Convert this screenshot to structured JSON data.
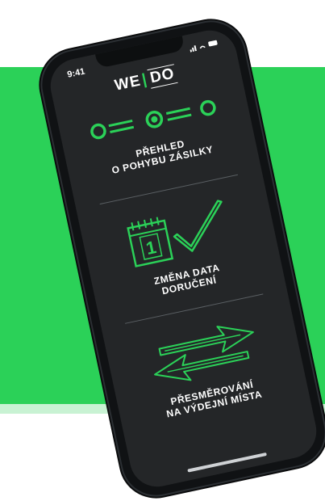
{
  "status": {
    "time": "9:41",
    "icons": "…• ▴ ▬"
  },
  "logo": {
    "left": "WE",
    "right": "DO"
  },
  "sections": [
    {
      "title": [
        "PŘEHLED",
        "O POHYBU ZÁSILKY"
      ]
    },
    {
      "title": [
        "ZMĚNA DATA",
        "DORUČENÍ"
      ],
      "calendar_day": "1"
    },
    {
      "title": [
        "PŘESMĚROVÁNÍ",
        "NA VÝDEJNÍ MÍSTA"
      ]
    }
  ],
  "colors": {
    "green": "#2bd158",
    "screen": "#242628",
    "frame": "#101214"
  },
  "icons": [
    "progress-tracker-icon",
    "calendar-icon",
    "checkmark-icon",
    "redirect-arrows-icon"
  ]
}
